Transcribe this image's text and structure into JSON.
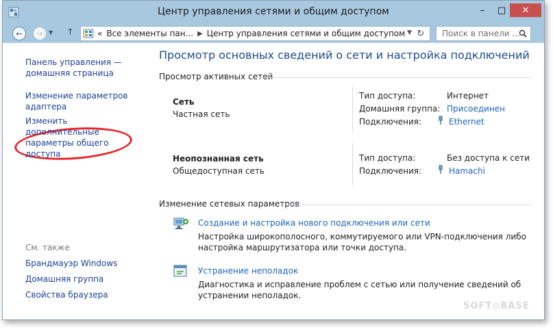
{
  "window": {
    "title": "Центр управления сетями и общим доступом",
    "controls": {
      "minimize": "–",
      "maximize": "□",
      "close": "✕"
    }
  },
  "address": {
    "crumb_prefix": "«",
    "crumbs": [
      "Все элементы пан...",
      "Центр управления сетями и общим доступом"
    ],
    "search_placeholder": "Поиск в панели ..."
  },
  "sidebar": {
    "home": "Панель управления — домашняя страница",
    "adapter": "Изменение параметров адаптера",
    "sharing": "Изменить дополнительные параметры общего доступа",
    "see_also": "См. также",
    "see_also_items": [
      "Брандмауэр Windows",
      "Домашняя группа",
      "Свойства браузера"
    ]
  },
  "main": {
    "title": "Просмотр основных сведений о сети и настройка подключений",
    "active_head": "Просмотр активных сетей",
    "networks": [
      {
        "name": "Сеть",
        "type": "Частная сеть",
        "props": [
          {
            "label": "Тип доступа:",
            "value": "Интернет",
            "link": false
          },
          {
            "label": "Домашняя группа:",
            "value": "Присоединен",
            "link": true
          },
          {
            "label": "Подключения:",
            "value": "Ethernet",
            "link": true
          }
        ]
      },
      {
        "name": "Неопознанная сеть",
        "type": "Общедоступная сеть",
        "props": [
          {
            "label": "Тип доступа:",
            "value": "Без доступа к сети",
            "link": false
          },
          {
            "label": "Подключения:",
            "value": "Hamachi",
            "link": true
          }
        ]
      }
    ],
    "change_head": "Изменение сетевых параметров",
    "tasks": [
      {
        "link": "Создание и настройка нового подключения или сети",
        "desc": "Настройка широкополосного, коммутируемого или VPN-подключения либо настройка маршрутизатора или точки доступа.",
        "icon": "new-connection-icon"
      },
      {
        "link": "Устранение неполадок",
        "desc": "Диагностика и исправление проблем с сетью или получение сведений об устранении неполадок.",
        "icon": "troubleshoot-icon"
      }
    ]
  },
  "watermark": "SOFT◎BASE",
  "colors": {
    "link": "#1c64b8",
    "title_blue": "#1e4b8f",
    "chrome": "#a8c8e0",
    "highlight": "#e8242b"
  }
}
